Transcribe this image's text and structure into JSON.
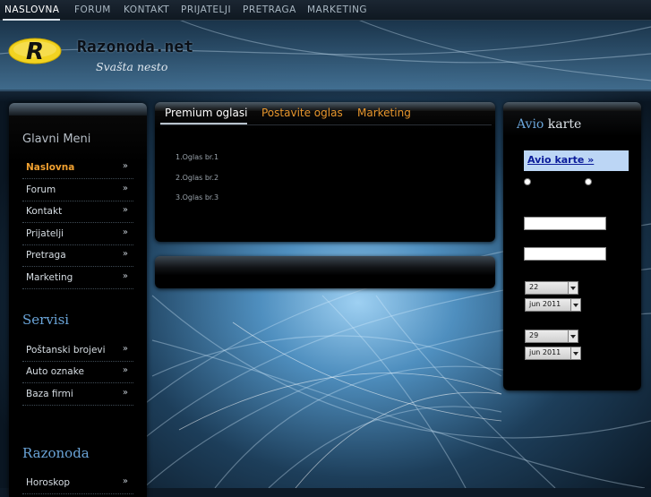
{
  "topnav": {
    "items": [
      "NASLOVNA",
      "FORUM",
      "KONTAKT",
      "PRIJATELJI",
      "PRETRAGA",
      "MARKETING"
    ],
    "active_index": 0
  },
  "header": {
    "logo_letter": "R",
    "site_name": "Razonoda.net",
    "slogan": "Svašta nesto"
  },
  "sidebar": {
    "main_title": "Glavni Meni",
    "main_items": [
      {
        "label": "Naslovna",
        "arrow": "»"
      },
      {
        "label": "Forum",
        "arrow": "»"
      },
      {
        "label": "Kontakt",
        "arrow": "»"
      },
      {
        "label": "Prijatelji",
        "arrow": "»"
      },
      {
        "label": "Pretraga",
        "arrow": "»"
      },
      {
        "label": "Marketing",
        "arrow": "»"
      }
    ],
    "services_title": "Servisi",
    "services_items": [
      {
        "label": "Poštanski brojevi",
        "arrow": "»"
      },
      {
        "label": "Auto oznake",
        "arrow": "»"
      },
      {
        "label": "Baza firmi",
        "arrow": "»"
      }
    ],
    "razonoda_title": "Razonoda",
    "razonoda_items": [
      {
        "label": "Horoskop",
        "arrow": "»"
      }
    ]
  },
  "center": {
    "tabs": [
      "Premium oglasi",
      "Postavite oglas",
      "Marketing"
    ],
    "ads": [
      "1.Oglas br.1",
      "2.Oglas br.2",
      "3.Oglas br.3"
    ]
  },
  "right": {
    "title_part1": "Avio",
    "title_part2": " karte",
    "link_label": "Avio karte »",
    "date1_day": "22",
    "date1_month": "jun 2011",
    "date2_day": "29",
    "date2_month": "jun 2011"
  },
  "colors": {
    "accent_orange": "#e8962c",
    "title_blue": "#6aa4d8",
    "link_box": "#bcd6f5"
  }
}
